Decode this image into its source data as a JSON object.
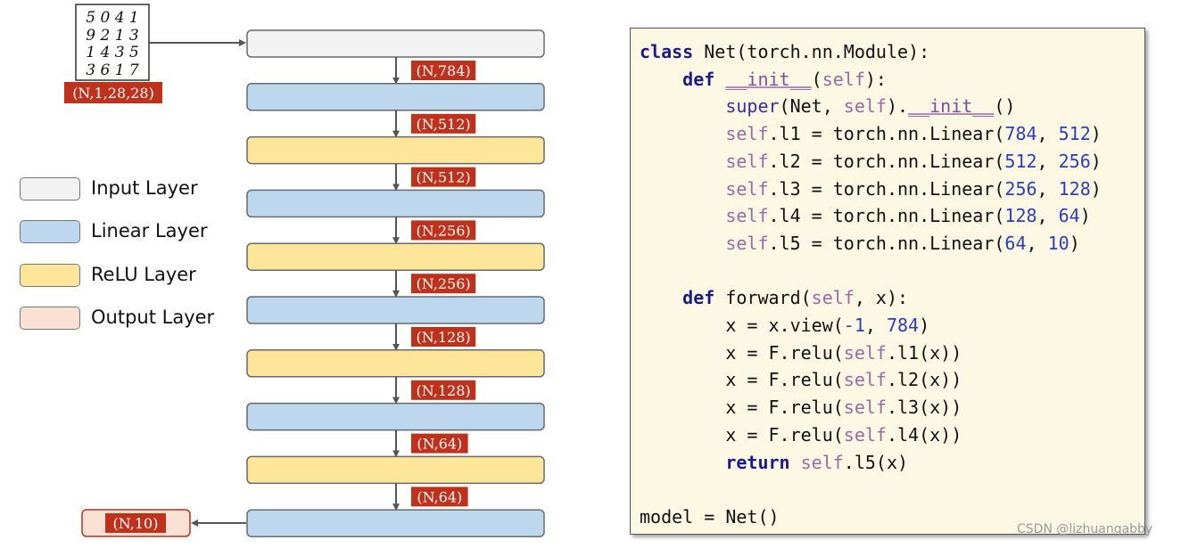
{
  "input_image": {
    "digit_rows": [
      "5 0 4 1",
      "9 2 1 3",
      "1 4 3 5",
      "3 6 1 7"
    ],
    "shape_label": "(N,1,28,28)"
  },
  "legend": [
    {
      "label": "Input Layer",
      "color": "#f2f2f2"
    },
    {
      "label": "Linear Layer",
      "color": "#bdd7ee"
    },
    {
      "label": "ReLU Layer",
      "color": "#fde59a"
    },
    {
      "label": "Output Layer",
      "color": "#fbe1d3"
    }
  ],
  "layers": [
    "input",
    "linear",
    "relu",
    "linear",
    "relu",
    "linear",
    "relu",
    "linear",
    "relu",
    "linear"
  ],
  "connector_labels": [
    "(N,784)",
    "(N,512)",
    "(N,512)",
    "(N,256)",
    "(N,256)",
    "(N,128)",
    "(N,128)",
    "(N,64)",
    "(N,64)"
  ],
  "output_label": "(N,10)",
  "colors": {
    "input": "#f2f2f2",
    "linear": "#bdd7ee",
    "relu": "#fde59a",
    "output": "#fbe1d3",
    "shape_badge": "#c0311c",
    "code_bg": "#fdf8e4"
  },
  "code": {
    "line1": {
      "kw": "class",
      "rest": " Net(torch.nn.Module):"
    },
    "line2": {
      "kw": "def",
      "fn": "__init__",
      "self": "self",
      "end": "):"
    },
    "line3": {
      "super": "super",
      "a": "(Net, ",
      "self": "self",
      "b": ").",
      "fn": "__init__",
      "end": "()"
    },
    "linear_lines": [
      {
        "self": "self",
        "attr": ".l1 = torch.nn.Linear(",
        "n1": "784",
        "sep": ", ",
        "n2": "512",
        "end": ")"
      },
      {
        "self": "self",
        "attr": ".l2 = torch.nn.Linear(",
        "n1": "512",
        "sep": ", ",
        "n2": "256",
        "end": ")"
      },
      {
        "self": "self",
        "attr": ".l3 = torch.nn.Linear(",
        "n1": "256",
        "sep": ", ",
        "n2": "128",
        "end": ")"
      },
      {
        "self": "self",
        "attr": ".l4 = torch.nn.Linear(",
        "n1": "128",
        "sep": ", ",
        "n2": "64",
        "end": ")"
      },
      {
        "self": "self",
        "attr": ".l5 = torch.nn.Linear(",
        "n1": "64",
        "sep": ", ",
        "n2": "10",
        "end": ")"
      }
    ],
    "forward_def": {
      "kw": "def",
      "a": " forward(",
      "self": "self",
      "b": ", x):"
    },
    "view_line": {
      "a": "x = x.view(",
      "n1": "-1",
      "sep": ", ",
      "n2": "784",
      "end": ")"
    },
    "relu_lines": [
      {
        "a": "x = F.relu(",
        "self": "self",
        "b": ".l1(x))"
      },
      {
        "a": "x = F.relu(",
        "self": "self",
        "b": ".l2(x))"
      },
      {
        "a": "x = F.relu(",
        "self": "self",
        "b": ".l3(x))"
      },
      {
        "a": "x = F.relu(",
        "self": "self",
        "b": ".l4(x))"
      }
    ],
    "return_line": {
      "kw": "return",
      "self": "self",
      "b": ".l5(x)"
    },
    "model_line": "model = Net()"
  },
  "watermark": "CSDN @lizhuangabby"
}
